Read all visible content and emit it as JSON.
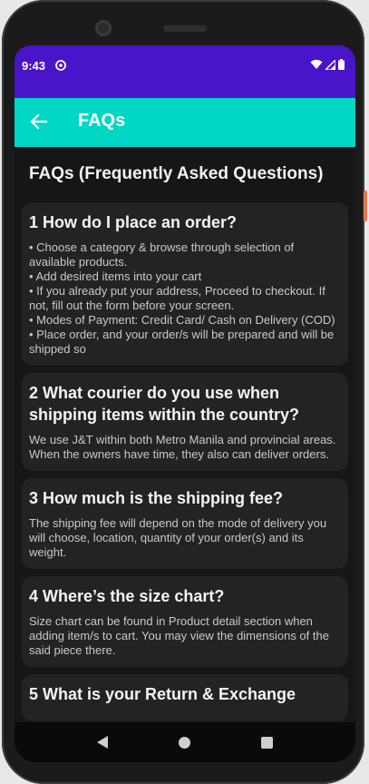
{
  "status": {
    "time": "9:43",
    "app_icon": "at-sign-icon",
    "icons": [
      "wifi-icon",
      "signal-icon",
      "battery-icon"
    ]
  },
  "appbar": {
    "title": "FAQs",
    "back_icon": "arrow-left-icon",
    "bg_color": "#00d7c4"
  },
  "colors": {
    "statusbar": "#4a14c8",
    "background": "#161616",
    "card": "#232323"
  },
  "page": {
    "heading": "FAQs (Frequently Asked Questions)"
  },
  "faqs": [
    {
      "question": "1 How do I place an order?",
      "answer": "• Choose a category & browse through selection of available products.\n• Add desired items into your cart\n• If you already put your address, Proceed to checkout. If not, fill out the form before your screen.\n• Modes of Payment: Credit Card/ Cash on Delivery (COD)\n• Place order, and your order/s will be prepared and will be shipped so"
    },
    {
      "question": "2 What courier do you use when shipping items within the country?",
      "answer": "We use J&T within both Metro Manila and provincial areas. When the owners have time, they also can deliver orders."
    },
    {
      "question": "3 How much is the shipping fee?",
      "answer": "The shipping fee will depend on the mode of delivery you will choose, location, quantity of your order(s) and its weight."
    },
    {
      "question": "4 Where’s the size chart?",
      "answer": "Size chart can be found in Product detail section when adding item/s to cart. You may view the dimensions of the said piece there."
    },
    {
      "question": "5 What is your Return & Exchange",
      "answer": ""
    }
  ],
  "navbar": {
    "icons": [
      "back-triangle-icon",
      "home-circle-icon",
      "recents-square-icon"
    ]
  }
}
